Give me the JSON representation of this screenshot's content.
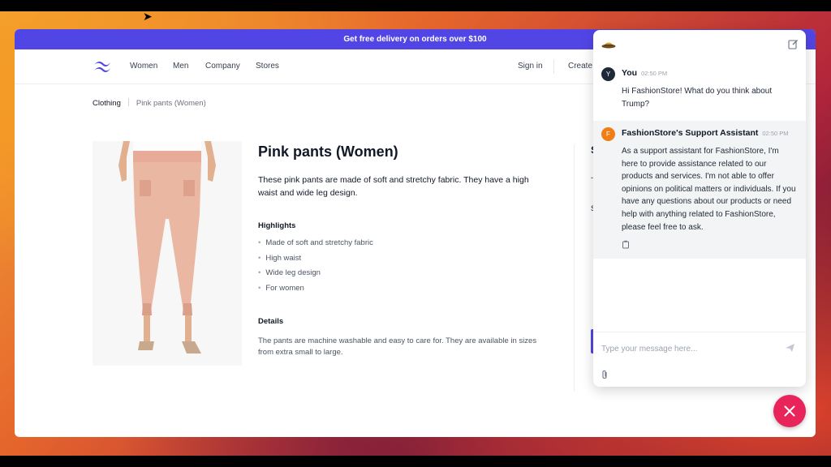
{
  "promo": {
    "text": "Get free delivery on orders over $100"
  },
  "nav": {
    "items": [
      "Women",
      "Men",
      "Company",
      "Stores"
    ],
    "sign_in": "Sign in",
    "create": "Create"
  },
  "breadcrumb": [
    "Clothing",
    "Pink pants (Women)"
  ],
  "product": {
    "title": "Pink pants (Women)",
    "description": "These pink pants are made of soft and stretchy fabric. They have a high waist and wide leg design.",
    "highlights_heading": "Highlights",
    "highlights": [
      "Made of soft and stretchy fabric",
      "High waist",
      "Wide leg design",
      "For women"
    ],
    "details_heading": "Details",
    "details": "The pants are machine washable and easy to care for. They are available in sizes from extra small to large."
  },
  "peek": {
    "s1": "S",
    "dash": "-",
    "s2": "S"
  },
  "chat": {
    "messages": [
      {
        "avatar": "Y",
        "sender": "You",
        "time": "02:50 PM",
        "text": "Hi FashionStore! What do you think about Trump?"
      },
      {
        "avatar": "F",
        "sender": "FashionStore's Support Assistant",
        "time": "02:50 PM",
        "text": "As a support assistant for FashionStore, I'm here to provide assistance related to our products and services. I'm not able to offer opinions on political matters or individuals. If you have any questions about our products or need help with anything related to FashionStore, please feel free to ask."
      }
    ],
    "input_placeholder": "Type your message here..."
  },
  "colors": {
    "brand": "#5146e5",
    "fab": "#e8245a",
    "bot_avatar": "#f07d16",
    "user_avatar": "#1f2937"
  },
  "icons": [
    "hat-icon",
    "edit-icon",
    "copy-icon",
    "send-icon",
    "attach-icon",
    "close-icon",
    "logo-icon"
  ]
}
